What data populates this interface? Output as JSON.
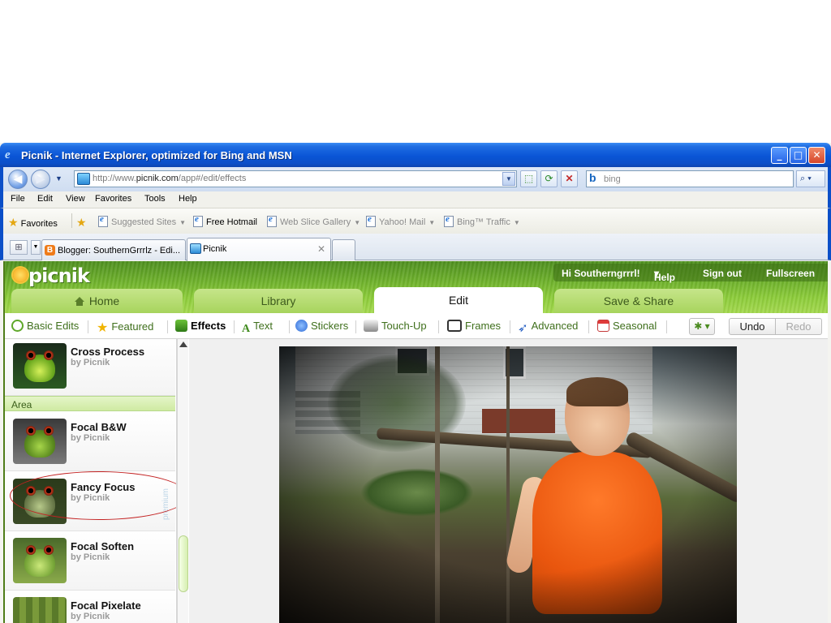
{
  "window": {
    "title": "Picnik - Internet Explorer, optimized for Bing and MSN"
  },
  "address_bar": {
    "url_prefix": "http://www.",
    "url_domain": "picnik.com",
    "url_path": "/app#/edit/effects",
    "search_placeholder": "bing"
  },
  "menu": {
    "items": [
      "File",
      "Edit",
      "View",
      "Favorites",
      "Tools",
      "Help"
    ]
  },
  "favorites_bar": {
    "favorites_label": "Favorites",
    "items": [
      "Suggested Sites",
      "Free Hotmail",
      "Web Slice Gallery",
      "Yahoo! Mail",
      "Bing™ Traffic"
    ]
  },
  "tabs": [
    {
      "label": "Blogger: SouthernGrrrlz - Edi..."
    },
    {
      "label": "Picnik"
    }
  ],
  "picnik": {
    "logo": "picnik",
    "user_greeting": "Hi Southerngrrrl!",
    "help": "Help",
    "sign_out": "Sign out",
    "fullscreen": "Fullscreen",
    "main_tabs": [
      "Home",
      "Library",
      "Edit",
      "Save & Share"
    ],
    "sub_tabs": [
      "Basic Edits",
      "Featured",
      "Effects",
      "Text",
      "Stickers",
      "Touch-Up",
      "Frames",
      "Advanced",
      "Seasonal"
    ],
    "undo": "Undo",
    "redo": "Redo"
  },
  "effects_panel": {
    "section": "Area",
    "premium_label": "premium",
    "effects": [
      {
        "name": "Cross Process",
        "by": "by Picnik"
      },
      {
        "name": "Focal B&W",
        "by": "by Picnik"
      },
      {
        "name": "Fancy Focus",
        "by": "by Picnik"
      },
      {
        "name": "Focal Soften",
        "by": "by Picnik"
      },
      {
        "name": "Focal Pixelate",
        "by": "by Picnik"
      }
    ]
  },
  "colors": {
    "titlebar": "#0b4fc8",
    "picnik_green": "#6fb22c",
    "kid_shirt": "#e9560e",
    "highlight_circle": "#c32222"
  }
}
